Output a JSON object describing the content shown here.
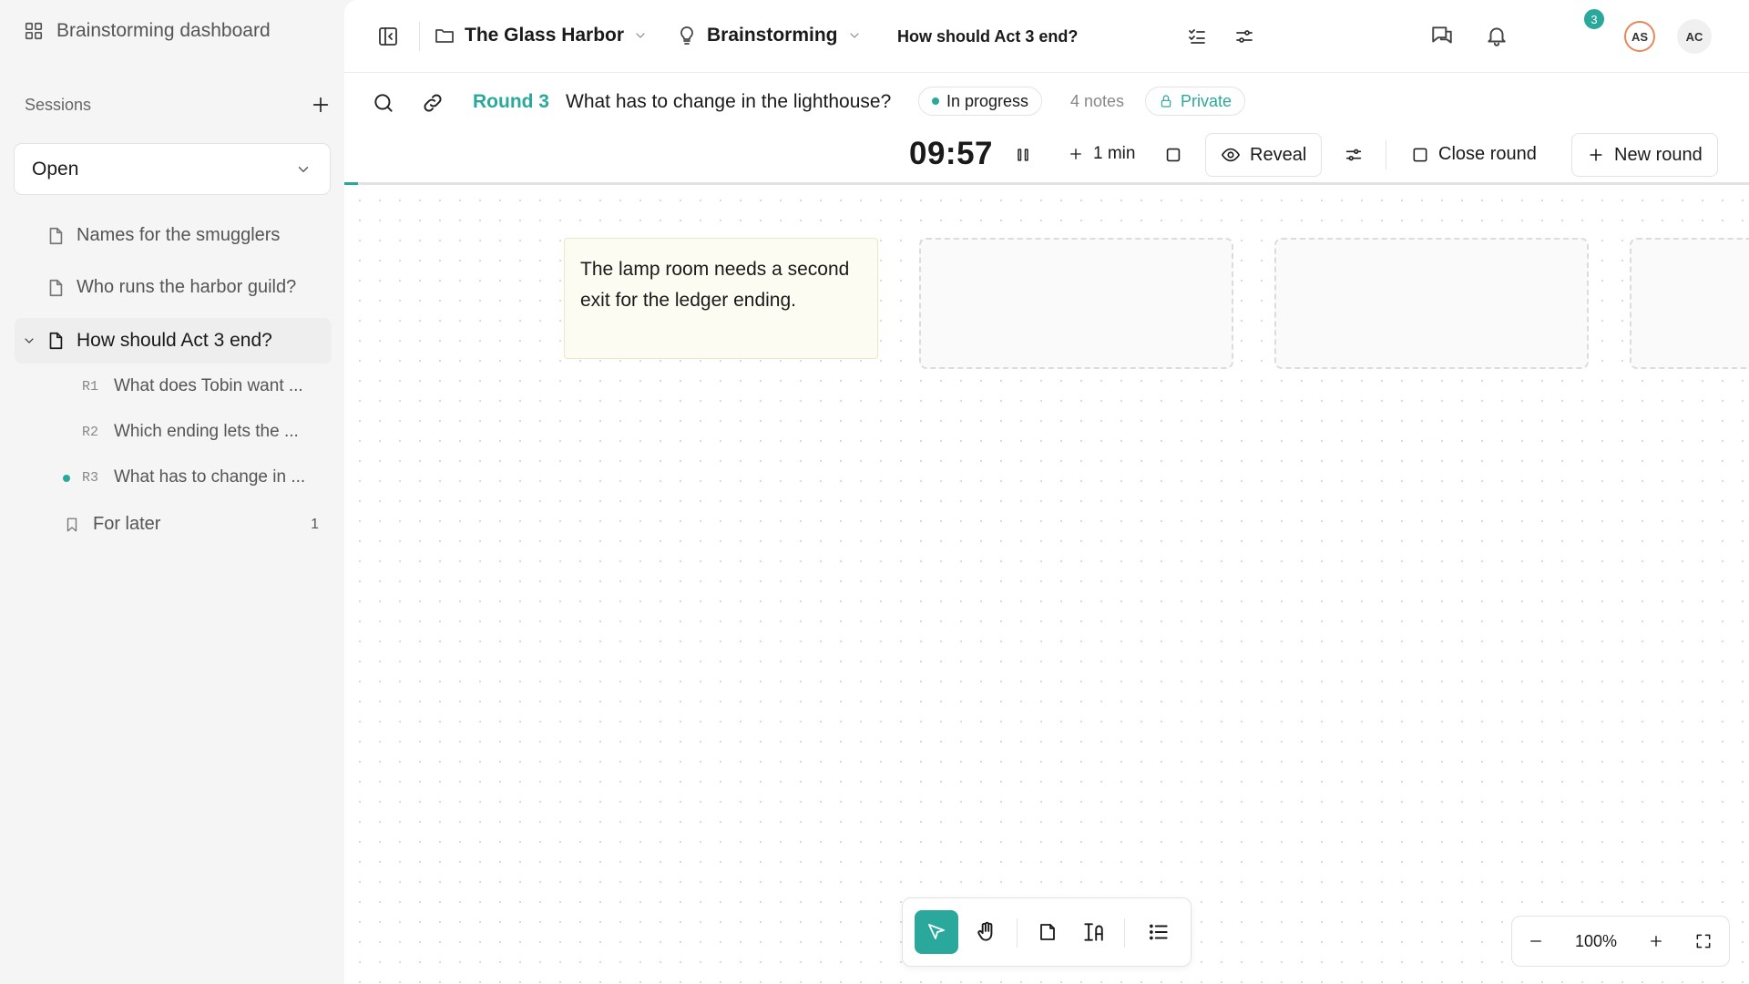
{
  "sidebar": {
    "title": "Brainstorming dashboard",
    "sessions_label": "Sessions",
    "filter_value": "Open",
    "items": [
      {
        "label": "Names for the smugglers"
      },
      {
        "label": "Who runs the harbor guild?"
      },
      {
        "label": "How should Act 3 end?"
      }
    ],
    "rounds": [
      {
        "tag": "R1",
        "label": "What does Tobin want ..."
      },
      {
        "tag": "R2",
        "label": "Which ending lets the ..."
      },
      {
        "tag": "R3",
        "label": "What has to change in ..."
      }
    ],
    "for_later": {
      "label": "For later",
      "count": "1"
    }
  },
  "topbar": {
    "project": "The Glass Harbor",
    "mode": "Brainstorming",
    "session_title": "How should Act 3 end?",
    "notification_count": "3",
    "avatars": [
      {
        "initials": "AS",
        "color": "#e8875a"
      },
      {
        "initials": "AC",
        "color": "#f0f0f0"
      }
    ]
  },
  "round": {
    "label": "Round 3",
    "question": "What has to change in the lighthouse?",
    "status": "In progress",
    "notes": "4 notes",
    "visibility": "Private",
    "timer": "09:57",
    "add_time": "1 min",
    "reveal": "Reveal",
    "close": "Close round",
    "new": "New round",
    "progress": 0.01
  },
  "canvas": {
    "note_text": "The lamp room needs a second exit for the ledger ending.",
    "empty_slots": 3
  },
  "zoom": {
    "value": "100%"
  },
  "colors": {
    "accent": "#2aa89b",
    "note_bg": "#fdfcf2",
    "avatar_as": "#e8875a"
  }
}
